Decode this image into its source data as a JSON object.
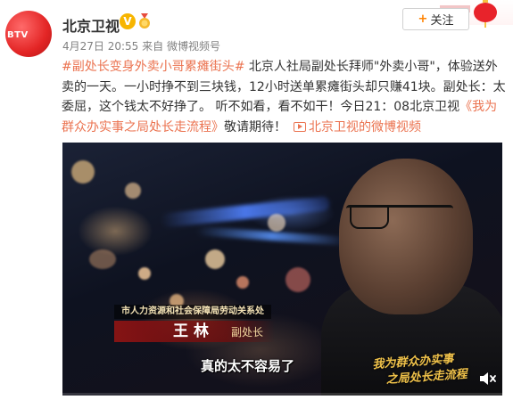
{
  "header": {
    "username": "北京卫视",
    "verified_badge": "V",
    "date": "4月27日 20:55",
    "source_prefix": "来自",
    "source": "微博视频号",
    "follow_label": "关注",
    "follow_plus": "+"
  },
  "post": {
    "hashtag": "#副处长变身外卖小哥累瘫街头#",
    "text1": " 北京人社局副处长拜师\"外卖小哥\"，体验送外卖的一天。一小时挣不到三块钱，12小时送单累瘫街头却只赚41块。副处长：太委屈，这个钱太不好挣了。 听不如看，看不如干！今日21：08北京卫视",
    "topic": "《我为群众办实事之局处长走流程》",
    "text2": "敬请期待！",
    "video_link": "北京卫视的微博视频"
  },
  "video": {
    "caption_org": "市人力资源和社会保障局劳动关系处",
    "caption_name": "王林",
    "caption_title": "副处长",
    "subtitle": "真的太不容易了",
    "show_logo_line1": "我为群众办实事",
    "show_logo_line2": "之局处长走流程",
    "progress_fraction": 0.0
  },
  "icons": {
    "verified": "verified-v-icon",
    "medal": "medal-icon",
    "video": "video-icon",
    "mute": "speaker-mute-icon"
  },
  "colors": {
    "link": "#eb7350",
    "badge": "#f7b500",
    "accent": "#ff8200"
  }
}
